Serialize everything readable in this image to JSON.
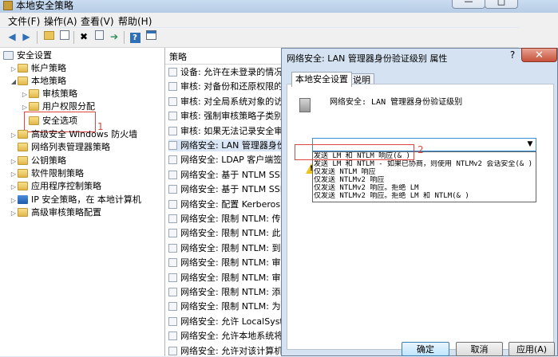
{
  "window": {
    "title": "本地安全策略",
    "minimize_label": "—",
    "maximize_label": "□",
    "close_label": "✕"
  },
  "menu": [
    "文件(F)",
    "操作(A)",
    "查看(V)",
    "帮助(H)"
  ],
  "toolbar": {
    "icons": [
      "back-icon",
      "forward-icon",
      "up-folder-icon",
      "show-tree-icon",
      "delete-icon",
      "properties-icon",
      "export-icon",
      "help-icon",
      "console-icon"
    ]
  },
  "tree": {
    "root": "安全设置",
    "items": [
      {
        "label": "帐户策略",
        "level": 1,
        "expanded": false
      },
      {
        "label": "本地策略",
        "level": 1,
        "expanded": true
      },
      {
        "label": "审核策略",
        "level": 2,
        "expanded": false
      },
      {
        "label": "用户权限分配",
        "level": 2,
        "expanded": false
      },
      {
        "label": "安全选项",
        "level": 2,
        "expanded": false,
        "selected": true
      },
      {
        "label": "高级安全 Windows 防火墙",
        "level": 1,
        "expanded": false
      },
      {
        "label": "网络列表管理器策略",
        "level": 1,
        "expanded": false
      },
      {
        "label": "公钥策略",
        "level": 1,
        "expanded": false
      },
      {
        "label": "软件限制策略",
        "level": 1,
        "expanded": false
      },
      {
        "label": "应用程序控制策略",
        "level": 1,
        "expanded": false
      },
      {
        "label": "IP 安全策略，在 本地计算机",
        "level": 1,
        "expanded": false
      },
      {
        "label": "高级审核策略配置",
        "level": 1,
        "expanded": false
      }
    ],
    "annotation_1": "1"
  },
  "list": {
    "header": "策略",
    "rows": [
      "设备: 允许在未登录的情况下",
      "审核: 对备份和还原权限的使",
      "审核: 对全局系统对象的访问",
      "审核: 强制审核策略子类别设",
      "审核: 如果无法记录安全审核",
      "网络安全: LAN 管理器身份验",
      "网络安全: LDAP 客户端签名",
      "网络安全: 基于 NTLM SSP 的",
      "网络安全: 基于 NTLM SSP 的",
      "网络安全: 配置 Kerberos 允",
      "网络安全: 限制 NTLM: 传入",
      "网络安全: 限制 NTLM: 此域",
      "网络安全: 限制 NTLM: 到远程",
      "网络安全: 限制 NTLM: 审核",
      "网络安全: 限制 NTLM: 审核",
      "网络安全: 限制 NTLM: 添加",
      "网络安全: 限制 NTLM: 为 N",
      "网络安全: 允许 LocalSystem",
      "网络安全: 允许本地系统将计",
      "网络安全: 允许对该计算机的"
    ],
    "selected_index": 5
  },
  "dialog": {
    "title": "网络安全: LAN 管理器身份验证级别 属性",
    "help_label": "?",
    "close_label": "✕",
    "tabs": [
      "本地安全设置",
      "说明"
    ],
    "policy_name": "网络安全: LAN 管理器身份验证级别",
    "dropdown_options": [
      "发送 LM 和 NTLM 响应(& )",
      "发送 LM 和 NTLM - 如果已协商，则使用 NTLMv2 会话安全(& )",
      "仅发送 NTLM 响应",
      "仅发送 NTLMv2 响应",
      "仅发送 NTLMv2 响应。拒绝 LM",
      "仅发送 NTLMv2 响应。拒绝 LM 和 NTLM(& )"
    ],
    "annotation_2": "2",
    "buttons": {
      "ok": "确定",
      "cancel": "取消",
      "apply": "应用(A)"
    }
  }
}
